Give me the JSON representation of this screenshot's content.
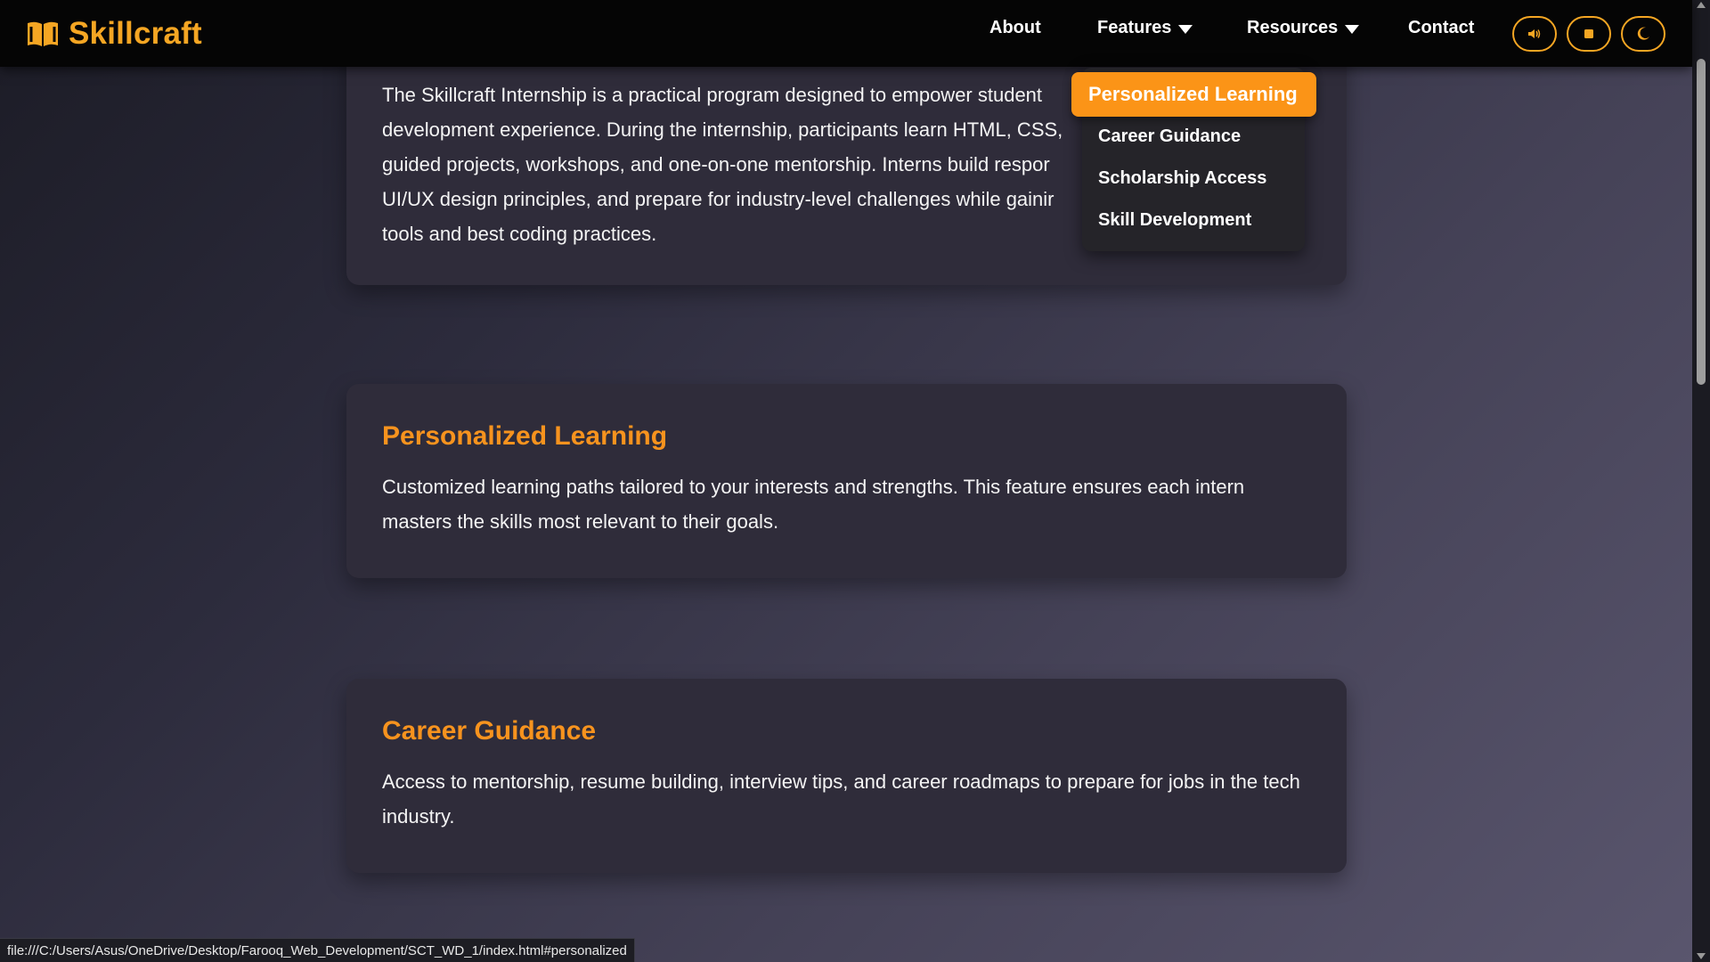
{
  "brand": {
    "name": "Skillcraft",
    "icon": "open-book-icon"
  },
  "nav": {
    "about": "About",
    "features": "Features",
    "resources": "Resources",
    "contact": "Contact",
    "buttons": [
      {
        "icon": "speaker-icon"
      },
      {
        "icon": "stop-icon"
      },
      {
        "icon": "moon-icon"
      }
    ]
  },
  "features_menu": {
    "items": [
      "Personalized Learning",
      "Career Guidance",
      "Scholarship Access",
      "Skill Development"
    ],
    "active": "Personalized Learning"
  },
  "intro": {
    "lines": [
      "The Skillcraft Internship is a practical program designed to empower student",
      "development experience. During the internship, participants learn HTML, CSS,",
      "guided projects, workshops, and one-on-one mentorship. Interns build respor",
      "UI/UX design principles, and prepare for industry-level challenges while gainir",
      "tools and best coding practices."
    ]
  },
  "sections": [
    {
      "title": "Personalized Learning",
      "text": "Customized learning paths tailored to your interests and strengths. This feature ensures each intern masters the skills most relevant to their goals."
    },
    {
      "title": "Career Guidance",
      "text": "Access to mentorship, resume building, interview tips, and career roadmaps to prepare for jobs in the tech industry."
    }
  ],
  "status_url": "file:///C:/Users/Asus/OneDrive/Desktop/Farooq_Web_Development/SCT_WD_1/index.html#personalized",
  "colors": {
    "accent": "#f7931e",
    "navbar": "#050505",
    "card": "#2f2c3a"
  }
}
